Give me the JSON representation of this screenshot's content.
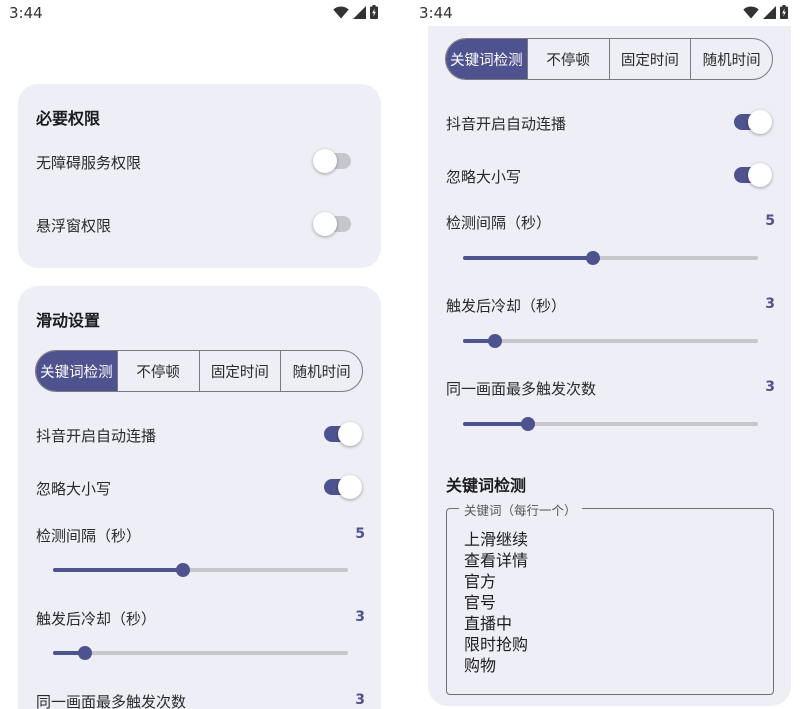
{
  "status_bar": {
    "time": "3:44"
  },
  "left_screen": {
    "permissions_card": {
      "title": "必要权限",
      "items": [
        {
          "label": "无障碍服务权限",
          "enabled": false
        },
        {
          "label": "悬浮窗权限",
          "enabled": false
        }
      ]
    },
    "swipe_card": {
      "title": "滑动设置",
      "modes": [
        "关键词检测",
        "不停顿",
        "固定时间",
        "随机时间"
      ],
      "selected_mode": "关键词检测",
      "toggles": [
        {
          "label": "抖音开启自动连播",
          "enabled": true
        },
        {
          "label": "忽略大小写",
          "enabled": true
        }
      ],
      "sliders": [
        {
          "label": "检测间隔（秒）",
          "value": "5",
          "fraction": 0.44
        },
        {
          "label": "触发后冷却（秒）",
          "value": "3",
          "fraction": 0.11
        },
        {
          "label": "同一画面最多触发次数",
          "value": "3"
        }
      ]
    }
  },
  "right_screen": {
    "modes": [
      "关键词检测",
      "不停顿",
      "固定时间",
      "随机时间"
    ],
    "selected_mode": "关键词检测",
    "toggles": [
      {
        "label": "抖音开启自动连播",
        "enabled": true
      },
      {
        "label": "忽略大小写",
        "enabled": true
      }
    ],
    "sliders": [
      {
        "label": "检测间隔（秒）",
        "value": "5",
        "fraction": 0.44
      },
      {
        "label": "触发后冷却（秒）",
        "value": "3",
        "fraction": 0.11
      },
      {
        "label": "同一画面最多触发次数",
        "value": "3",
        "fraction": 0.22
      }
    ],
    "keyword_section": {
      "title": "关键词检测",
      "field_label": "关键词（每行一个）",
      "keywords": [
        "上滑继续",
        "查看详情",
        "官方",
        "官号",
        "直播中",
        "限时抢购",
        "购物"
      ]
    }
  },
  "colors": {
    "accent": "#4e5390",
    "card_background": "#eeeef7",
    "switch_off_track": "#c6c6cc"
  },
  "icons": [
    "wifi-icon",
    "cell-signal-icon",
    "battery-charging-icon"
  ]
}
